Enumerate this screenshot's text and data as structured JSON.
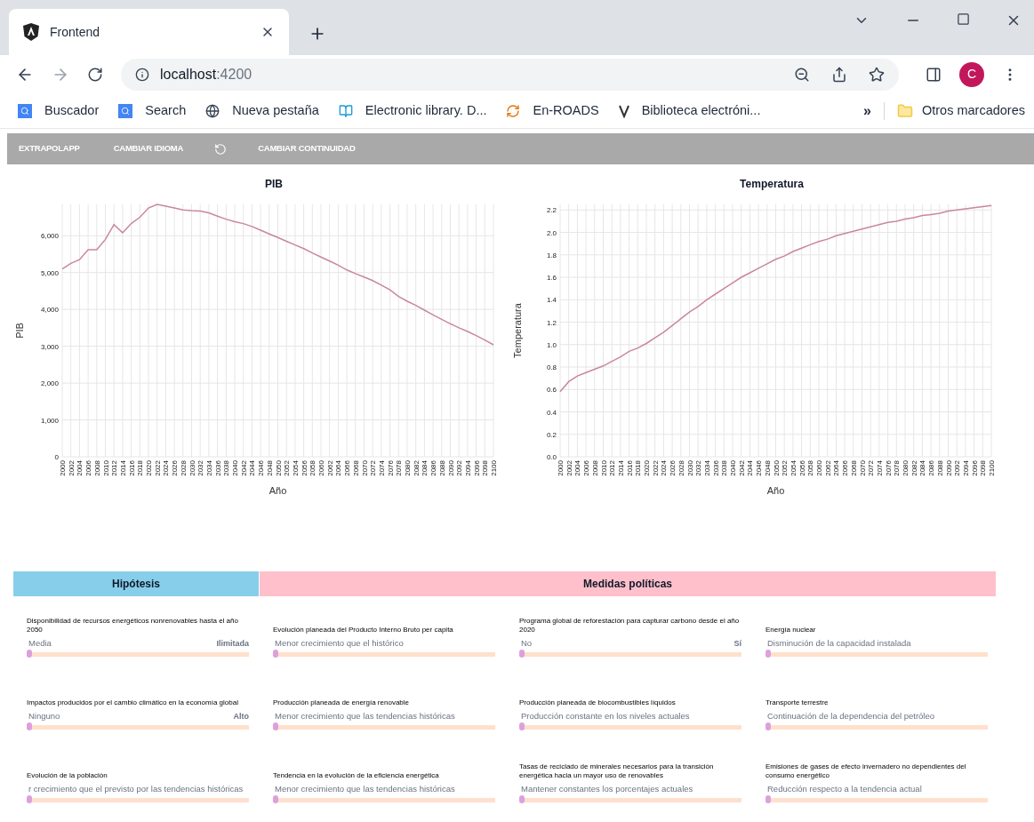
{
  "browser": {
    "tab": {
      "title": "Frontend",
      "selected": true
    },
    "url": {
      "host": "localhost",
      "port": ":4200"
    },
    "avatar": "C",
    "bookmarks": [
      {
        "kind": "search",
        "label": "Buscador"
      },
      {
        "kind": "search",
        "label": "Search"
      },
      {
        "kind": "globe",
        "label": "Nueva pestaña"
      },
      {
        "kind": "book",
        "label": "Electronic library. D..."
      },
      {
        "kind": "cycle",
        "label": "En-ROADS"
      },
      {
        "kind": "v",
        "label": "Biblioteca electróni..."
      }
    ],
    "more": "»",
    "other": "Otros marcadores"
  },
  "app_bar": [
    {
      "kind": "text",
      "label": "EXTRAPOLAPP"
    },
    {
      "kind": "text",
      "label": "CAMBIAR IDIOMA"
    },
    {
      "kind": "undo"
    },
    {
      "kind": "text",
      "label": "CAMBIAR CONTINUIDAD"
    }
  ],
  "charts": [
    {
      "chart_data": {
        "type": "line",
        "title": "PIB",
        "xlabel": "Año",
        "ylabel": "PIB",
        "x": [
          2000,
          2002,
          2004,
          2006,
          2008,
          2010,
          2012,
          2014,
          2016,
          2018,
          2020,
          2022,
          2024,
          2026,
          2028,
          2030,
          2032,
          2034,
          2036,
          2038,
          2040,
          2042,
          2044,
          2046,
          2048,
          2050,
          2052,
          2054,
          2056,
          2058,
          2060,
          2062,
          2064,
          2066,
          2068,
          2070,
          2072,
          2074,
          2076,
          2078,
          2080,
          2082,
          2084,
          2086,
          2088,
          2090,
          2092,
          2094,
          2096,
          2098,
          2100
        ],
        "grid": true,
        "series": [
          {
            "color": "#c9879e",
            "values": [
              5100,
              5250,
              5350,
              5620,
              5620,
              5900,
              6300,
              6080,
              6330,
              6500,
              6750,
              6850,
              6800,
              6750,
              6700,
              6680,
              6670,
              6620,
              6530,
              6450,
              6380,
              6330,
              6250,
              6150,
              6050,
              5950,
              5850,
              5750,
              5650,
              5530,
              5420,
              5310,
              5200,
              5070,
              4970,
              4880,
              4780,
              4660,
              4530,
              4350,
              4220,
              4110,
              3980,
              3850,
              3730,
              3610,
              3500,
              3400,
              3290,
              3170,
              3040
            ]
          }
        ],
        "xlim": [
          2000,
          2100
        ],
        "ylim": [
          0,
          6850
        ],
        "xticks": [
          2000,
          2002,
          2004,
          2006,
          2008,
          2010,
          2012,
          2014,
          2016,
          2018,
          2020,
          2022,
          2024,
          2026,
          2028,
          2030,
          2032,
          2034,
          2036,
          2038,
          2040,
          2042,
          2044,
          2046,
          2048,
          2050,
          2052,
          2054,
          2056,
          2058,
          2060,
          2062,
          2064,
          2066,
          2068,
          2070,
          2072,
          2074,
          2076,
          2078,
          2080,
          2082,
          2084,
          2086,
          2088,
          2090,
          2092,
          2094,
          2096,
          2098,
          2100
        ],
        "yticks": [
          0,
          {
            "value": 1000,
            "label": "1,000"
          },
          {
            "value": 2000,
            "label": "2,000"
          },
          {
            "value": 3000,
            "label": "3,000"
          },
          {
            "value": 4000,
            "label": "4,000"
          },
          {
            "value": 5000,
            "label": "5,000"
          },
          {
            "value": 6000,
            "label": "6,000"
          }
        ]
      }
    },
    {
      "chart_data": {
        "type": "line",
        "title": "Temperatura",
        "xlabel": "Año",
        "ylabel": "Temperatura",
        "x": [
          2000,
          2002,
          2004,
          2006,
          2008,
          2010,
          2012,
          2014,
          2016,
          2018,
          2020,
          2022,
          2024,
          2026,
          2028,
          2030,
          2032,
          2034,
          2036,
          2038,
          2040,
          2042,
          2044,
          2046,
          2048,
          2050,
          2052,
          2054,
          2056,
          2058,
          2060,
          2062,
          2064,
          2066,
          2068,
          2070,
          2072,
          2074,
          2076,
          2078,
          2080,
          2082,
          2084,
          2086,
          2088,
          2090,
          2092,
          2094,
          2096,
          2098,
          2100
        ],
        "grid": true,
        "series": [
          {
            "color": "#c9879e",
            "values": [
              0.58,
              0.67,
              0.72,
              0.75,
              0.78,
              0.81,
              0.85,
              0.89,
              0.94,
              0.97,
              1.01,
              1.06,
              1.11,
              1.17,
              1.23,
              1.29,
              1.34,
              1.4,
              1.45,
              1.5,
              1.55,
              1.6,
              1.64,
              1.68,
              1.72,
              1.76,
              1.79,
              1.83,
              1.86,
              1.89,
              1.92,
              1.94,
              1.97,
              1.99,
              2.01,
              2.03,
              2.05,
              2.07,
              2.09,
              2.1,
              2.12,
              2.13,
              2.15,
              2.16,
              2.17,
              2.19,
              2.2,
              2.21,
              2.22,
              2.23,
              2.24
            ]
          }
        ],
        "xlim": [
          2000,
          2100
        ],
        "ylim": [
          0,
          2.25
        ],
        "xticks": [
          2000,
          2002,
          2004,
          2006,
          2008,
          2010,
          2012,
          2014,
          2016,
          2018,
          2020,
          2022,
          2024,
          2026,
          2028,
          2030,
          2032,
          2034,
          2036,
          2038,
          2040,
          2042,
          2044,
          2046,
          2048,
          2050,
          2052,
          2054,
          2056,
          2058,
          2060,
          2062,
          2064,
          2066,
          2068,
          2070,
          2072,
          2074,
          2076,
          2078,
          2080,
          2082,
          2084,
          2086,
          2088,
          2090,
          2092,
          2094,
          2096,
          2098,
          2100
        ],
        "yticks": [
          {
            "value": 0,
            "label": "0.0"
          },
          {
            "value": 0.2,
            "label": "0.2"
          },
          {
            "value": 0.4,
            "label": "0.4"
          },
          {
            "value": 0.6,
            "label": "0.6"
          },
          {
            "value": 0.8,
            "label": "0.8"
          },
          {
            "value": 1,
            "label": "1.0"
          },
          {
            "value": 1.2,
            "label": "1.2"
          },
          {
            "value": 1.4,
            "label": "1.4"
          },
          {
            "value": 1.6,
            "label": "1.6"
          },
          {
            "value": 1.8,
            "label": "1.8"
          },
          {
            "value": 2,
            "label": "2.0"
          },
          {
            "value": 2.2,
            "label": "2.2"
          }
        ]
      }
    }
  ],
  "sections": [
    {
      "title": "Hipótesis",
      "color": "#87ceeb",
      "columns": [
        [
          {
            "label": "Disponibilidad de recursos energéticos nonrenovables hasta el año 2050",
            "value": "Media",
            "max_label": "Ilimitada",
            "level": 0
          },
          {
            "label": "Impactos producidos por el cambio climático en la economía global",
            "value": "Ninguno",
            "max_label": "Alto",
            "level": 0
          },
          {
            "label": "Evolución de la población",
            "value": "r crecimiento que el previsto por las tendencias históricas",
            "level": 0
          }
        ]
      ]
    },
    {
      "title": "Medidas políticas",
      "color": "#ffc0cb",
      "columns": [
        [
          {
            "label": "Evolución planeada del Producto Interno Bruto per capita",
            "value": "Menor crecimiento que el histórico",
            "level": 0
          },
          {
            "label": "Producción planeada de energía renovable",
            "value": "Menor crecimiento que las tendencias históricas",
            "level": 0
          },
          {
            "label": "Tendencia en la evolución de la eficiencia energética",
            "value": "Menor crecimiento que las tendencias históricas",
            "level": 0
          }
        ],
        [
          {
            "label": "Programa global de reforestación para capturar carbono desde el año 2020",
            "value": "No",
            "max_label": "Sí",
            "level": 0
          },
          {
            "label": "Producción planeada de biocombustibles líquidos",
            "value": "Producción constante en los niveles actuales",
            "level": 0
          },
          {
            "label": "Tasas de reciclado de minerales necesarios para la transición energética hacia un mayor uso de renovables",
            "value": "Mantener constantes los porcentajes actuales",
            "level": 0
          }
        ],
        [
          {
            "label": "Energía nuclear",
            "value": "Disminución de la capacidad instalada",
            "level": 0
          },
          {
            "label": "Transporte terrestre",
            "value": "Continuación de la dependencia del petróleo",
            "level": 0
          },
          {
            "label": "Emisiones de gases de efecto invernadero no dependientes del consumo energético",
            "value": "Reducción respecto a la tendencia actual",
            "level": 0
          }
        ]
      ]
    }
  ]
}
